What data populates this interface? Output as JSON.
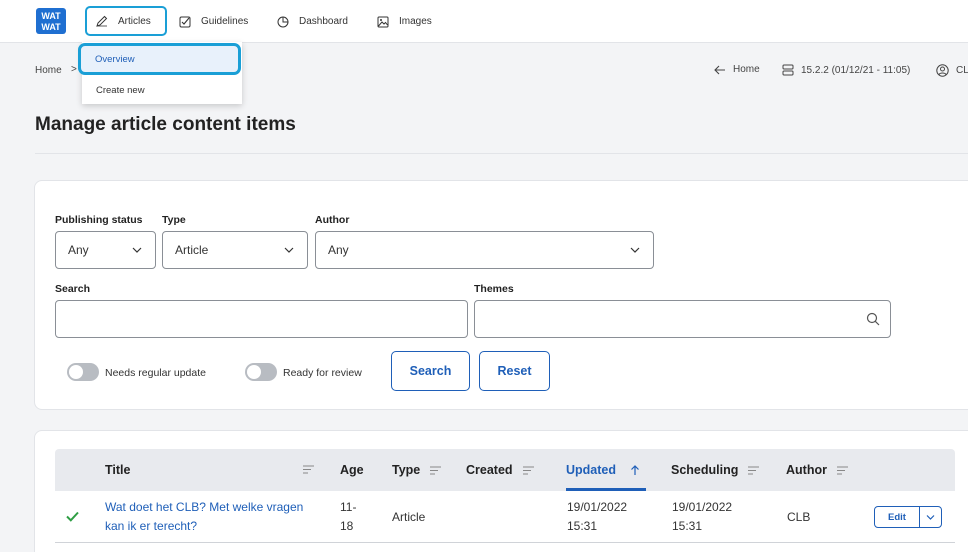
{
  "logo": {
    "line1": "WAT",
    "line2": "WAT",
    "color": "#1f6fd1"
  },
  "nav": {
    "items": [
      {
        "label": "Articles",
        "icon": "pencil-icon"
      },
      {
        "label": "Guidelines",
        "icon": "checkbox-icon"
      },
      {
        "label": "Dashboard",
        "icon": "pie-chart-icon"
      },
      {
        "label": "Images",
        "icon": "image-icon"
      }
    ],
    "dropdown": [
      {
        "label": "Overview"
      },
      {
        "label": "Create new"
      }
    ]
  },
  "breadcrumb": {
    "home": "Home",
    "separator": ">"
  },
  "meta": {
    "home": "Home",
    "version": "15.2.2 (01/12/21 - 11:05)",
    "user": "CLB"
  },
  "page_title": "Manage article content items",
  "filters": {
    "publishing_status": {
      "label": "Publishing status",
      "value": "Any"
    },
    "type": {
      "label": "Type",
      "value": "Article"
    },
    "author": {
      "label": "Author",
      "value": "Any"
    },
    "search": {
      "label": "Search",
      "value": ""
    },
    "themes": {
      "label": "Themes",
      "value": ""
    },
    "toggles": [
      {
        "label": "Needs regular update",
        "on": false
      },
      {
        "label": "Ready for review",
        "on": false
      }
    ],
    "search_button": "Search",
    "reset_button": "Reset"
  },
  "table": {
    "columns": [
      "Title",
      "Age",
      "Type",
      "Created",
      "Updated",
      "Scheduling",
      "Author"
    ],
    "sorted_column": "Updated",
    "rows": [
      {
        "title_line1": "Wat doet het CLB? Met welke vragen",
        "title_line2": "kan ik er terecht?",
        "age_line1": "11-",
        "age_line2": "18",
        "type": "Article",
        "created": "",
        "updated_line1": "19/01/2022",
        "updated_line2": "15:31",
        "scheduling_line1": "19/01/2022",
        "scheduling_line2": "15:31",
        "author": "CLB",
        "edit_label": "Edit",
        "status_icon": "checkmark-icon"
      }
    ]
  },
  "colors": {
    "accent": "#1f5fb8",
    "highlight": "#1a9fd6",
    "success": "#2e9e44"
  }
}
